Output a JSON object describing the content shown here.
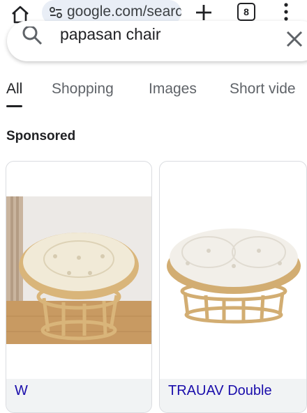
{
  "browser": {
    "url": "google.com/searc",
    "tab_count": "8"
  },
  "search": {
    "query": "papasan chair"
  },
  "tabs": [
    {
      "label": "All",
      "active": true
    },
    {
      "label": "Shopping",
      "active": false
    },
    {
      "label": "Images",
      "active": false
    },
    {
      "label": "Short vide",
      "active": false
    }
  ],
  "section": {
    "sponsored_label": "Sponsored"
  },
  "products": [
    {
      "title": "W"
    },
    {
      "title": "TRAUAV Double"
    }
  ],
  "colors": {
    "url_bg": "#e9eef6",
    "link": "#1a0dab",
    "text": "#202124",
    "muted": "#5f6368"
  }
}
